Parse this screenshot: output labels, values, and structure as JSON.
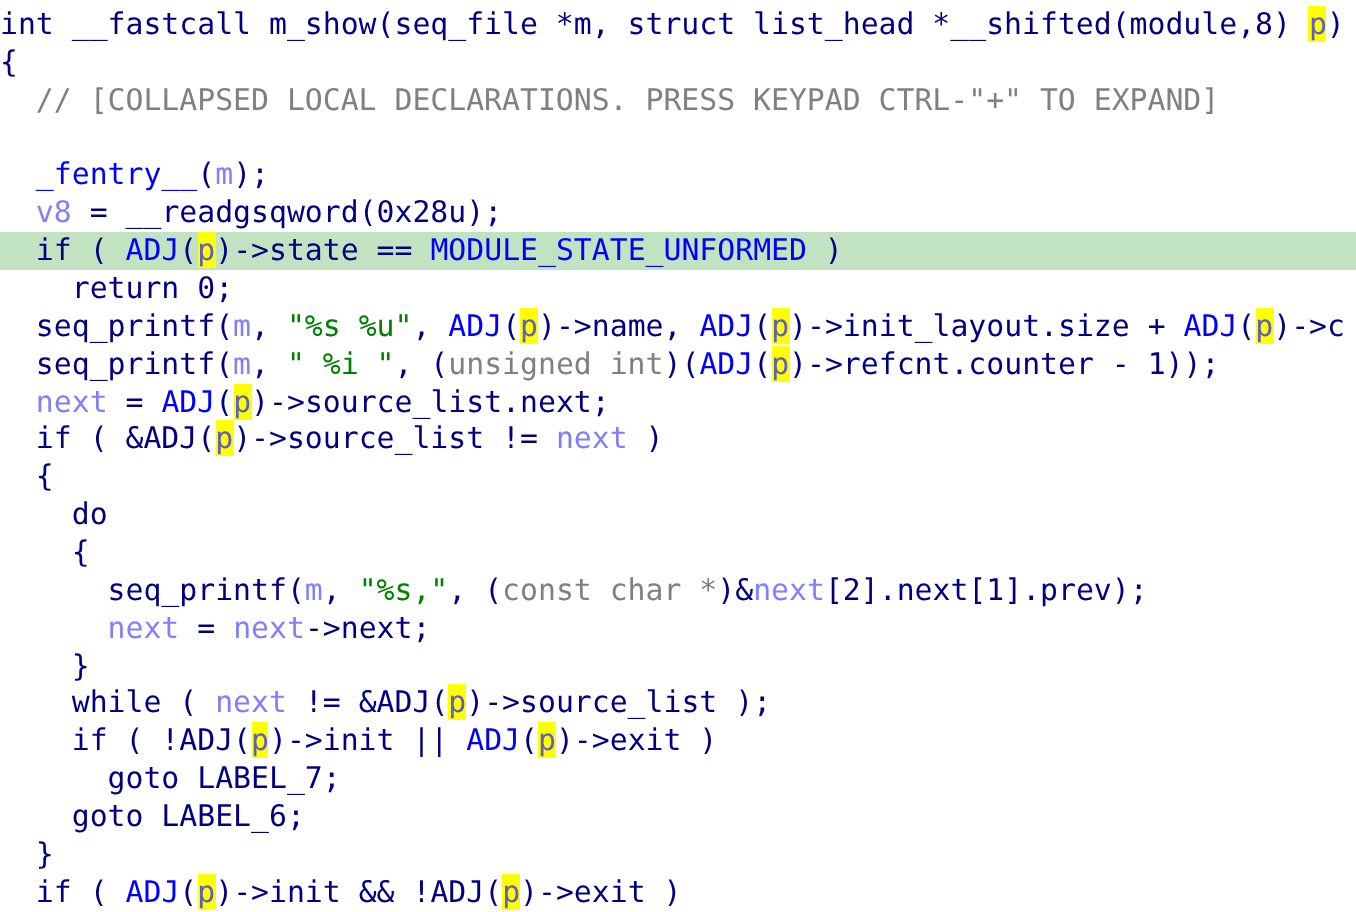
{
  "lines": [
    {
      "kind": "code",
      "selected": false,
      "tokens": [
        {
          "kind": "plain",
          "text": "int __fastcall m_show(seq_file *m, struct list_head *__shifted(module,8) "
        },
        {
          "kind": "hl",
          "text": "p"
        },
        {
          "kind": "plain",
          "text": ")"
        }
      ]
    },
    {
      "kind": "code",
      "selected": false,
      "tokens": [
        {
          "kind": "plain",
          "text": "{"
        }
      ]
    },
    {
      "kind": "code",
      "selected": false,
      "tokens": [
        {
          "kind": "comment",
          "text": "  // [COLLAPSED LOCAL DECLARATIONS. PRESS KEYPAD CTRL-\"+\" TO EXPAND]"
        }
      ]
    },
    {
      "kind": "blank"
    },
    {
      "kind": "code",
      "selected": false,
      "tokens": [
        {
          "kind": "name",
          "text": "  _fentry__"
        },
        {
          "kind": "plain",
          "text": "("
        },
        {
          "kind": "var",
          "text": "m"
        },
        {
          "kind": "plain",
          "text": ");"
        }
      ]
    },
    {
      "kind": "code",
      "selected": false,
      "tokens": [
        {
          "kind": "var",
          "text": "  v8"
        },
        {
          "kind": "plain",
          "text": " = __readgsqword(0x28u);"
        }
      ]
    },
    {
      "kind": "code",
      "selected": true,
      "tokens": [
        {
          "kind": "plain",
          "text": "  if ( "
        },
        {
          "kind": "name",
          "text": "ADJ"
        },
        {
          "kind": "plain",
          "text": "("
        },
        {
          "kind": "hl",
          "text": "p"
        },
        {
          "kind": "plain",
          "text": ")->state == "
        },
        {
          "kind": "name",
          "text": "MODULE_STATE_UNFORMED"
        },
        {
          "kind": "plain",
          "text": " )"
        }
      ]
    },
    {
      "kind": "code",
      "selected": false,
      "tokens": [
        {
          "kind": "plain",
          "text": "    return 0;"
        }
      ]
    },
    {
      "kind": "code",
      "selected": false,
      "tokens": [
        {
          "kind": "plain",
          "text": "  seq_printf("
        },
        {
          "kind": "var",
          "text": "m"
        },
        {
          "kind": "plain",
          "text": ", "
        },
        {
          "kind": "string",
          "text": "\"%s %u\""
        },
        {
          "kind": "plain",
          "text": ", "
        },
        {
          "kind": "name",
          "text": "ADJ"
        },
        {
          "kind": "plain",
          "text": "("
        },
        {
          "kind": "hl",
          "text": "p"
        },
        {
          "kind": "plain",
          "text": ")->name, "
        },
        {
          "kind": "name",
          "text": "ADJ"
        },
        {
          "kind": "plain",
          "text": "("
        },
        {
          "kind": "hl",
          "text": "p"
        },
        {
          "kind": "plain",
          "text": ")->init_layout.size + "
        },
        {
          "kind": "name",
          "text": "ADJ"
        },
        {
          "kind": "plain",
          "text": "("
        },
        {
          "kind": "hl",
          "text": "p"
        },
        {
          "kind": "plain",
          "text": ")->c"
        }
      ]
    },
    {
      "kind": "code",
      "selected": false,
      "tokens": [
        {
          "kind": "plain",
          "text": "  seq_printf("
        },
        {
          "kind": "var",
          "text": "m"
        },
        {
          "kind": "plain",
          "text": ", "
        },
        {
          "kind": "string",
          "text": "\" %i \""
        },
        {
          "kind": "plain",
          "text": ", ("
        },
        {
          "kind": "type",
          "text": "unsigned int"
        },
        {
          "kind": "plain",
          "text": ")("
        },
        {
          "kind": "name",
          "text": "ADJ"
        },
        {
          "kind": "plain",
          "text": "("
        },
        {
          "kind": "hl",
          "text": "p"
        },
        {
          "kind": "plain",
          "text": ")->refcnt.counter - 1));"
        }
      ]
    },
    {
      "kind": "code",
      "selected": false,
      "tokens": [
        {
          "kind": "var",
          "text": "  next"
        },
        {
          "kind": "plain",
          "text": " = "
        },
        {
          "kind": "name",
          "text": "ADJ"
        },
        {
          "kind": "plain",
          "text": "("
        },
        {
          "kind": "hl",
          "text": "p"
        },
        {
          "kind": "plain",
          "text": ")->source_list.next;"
        }
      ]
    },
    {
      "kind": "code",
      "selected": false,
      "tokens": [
        {
          "kind": "plain",
          "text": "  if ( &ADJ("
        },
        {
          "kind": "hl",
          "text": "p"
        },
        {
          "kind": "plain",
          "text": ")->source_list != "
        },
        {
          "kind": "var",
          "text": "next"
        },
        {
          "kind": "plain",
          "text": " )"
        }
      ]
    },
    {
      "kind": "code",
      "selected": false,
      "tokens": [
        {
          "kind": "plain",
          "text": "  {"
        }
      ]
    },
    {
      "kind": "code",
      "selected": false,
      "tokens": [
        {
          "kind": "plain",
          "text": "    do"
        }
      ]
    },
    {
      "kind": "code",
      "selected": false,
      "tokens": [
        {
          "kind": "plain",
          "text": "    {"
        }
      ]
    },
    {
      "kind": "code",
      "selected": false,
      "tokens": [
        {
          "kind": "plain",
          "text": "      seq_printf("
        },
        {
          "kind": "var",
          "text": "m"
        },
        {
          "kind": "plain",
          "text": ", "
        },
        {
          "kind": "string",
          "text": "\"%s,\""
        },
        {
          "kind": "plain",
          "text": ", ("
        },
        {
          "kind": "type",
          "text": "const char *"
        },
        {
          "kind": "plain",
          "text": ")&"
        },
        {
          "kind": "var",
          "text": "next"
        },
        {
          "kind": "plain",
          "text": "[2].next[1].prev);"
        }
      ]
    },
    {
      "kind": "code",
      "selected": false,
      "tokens": [
        {
          "kind": "var",
          "text": "      next"
        },
        {
          "kind": "plain",
          "text": " = "
        },
        {
          "kind": "var",
          "text": "next"
        },
        {
          "kind": "plain",
          "text": "->next;"
        }
      ]
    },
    {
      "kind": "code",
      "selected": false,
      "tokens": [
        {
          "kind": "plain",
          "text": "    }"
        }
      ]
    },
    {
      "kind": "code",
      "selected": false,
      "tokens": [
        {
          "kind": "plain",
          "text": "    while ( "
        },
        {
          "kind": "var",
          "text": "next"
        },
        {
          "kind": "plain",
          "text": " != &ADJ("
        },
        {
          "kind": "hl",
          "text": "p"
        },
        {
          "kind": "plain",
          "text": ")->source_list );"
        }
      ]
    },
    {
      "kind": "code",
      "selected": false,
      "tokens": [
        {
          "kind": "plain",
          "text": "    if ( !ADJ("
        },
        {
          "kind": "hl",
          "text": "p"
        },
        {
          "kind": "plain",
          "text": ")->init || "
        },
        {
          "kind": "name",
          "text": "ADJ"
        },
        {
          "kind": "plain",
          "text": "("
        },
        {
          "kind": "hl",
          "text": "p"
        },
        {
          "kind": "plain",
          "text": ")->exit )"
        }
      ]
    },
    {
      "kind": "code",
      "selected": false,
      "tokens": [
        {
          "kind": "plain",
          "text": "      goto LABEL_7;"
        }
      ]
    },
    {
      "kind": "code",
      "selected": false,
      "tokens": [
        {
          "kind": "plain",
          "text": "    goto LABEL_6;"
        }
      ]
    },
    {
      "kind": "code",
      "selected": false,
      "tokens": [
        {
          "kind": "plain",
          "text": "  }"
        }
      ]
    },
    {
      "kind": "code",
      "selected": false,
      "tokens": [
        {
          "kind": "plain",
          "text": "  if ( "
        },
        {
          "kind": "name",
          "text": "ADJ"
        },
        {
          "kind": "plain",
          "text": "("
        },
        {
          "kind": "hl",
          "text": "p"
        },
        {
          "kind": "plain",
          "text": ")->init && !ADJ("
        },
        {
          "kind": "hl",
          "text": "p"
        },
        {
          "kind": "plain",
          "text": ")->exit )"
        }
      ]
    }
  ]
}
